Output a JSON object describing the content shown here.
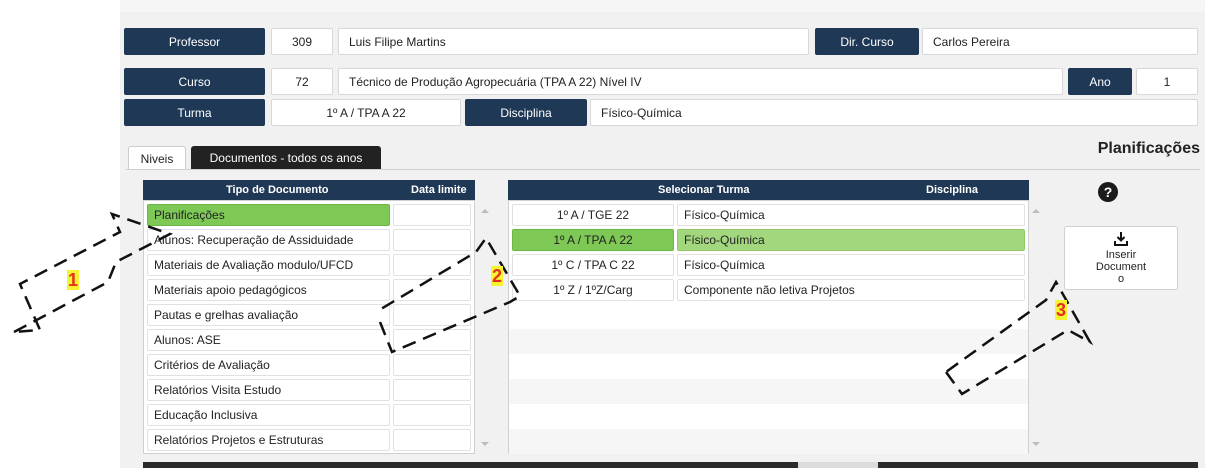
{
  "header": {
    "professor_label": "Professor",
    "professor_num": "309",
    "professor_name": "Luis Filipe Martins",
    "dir_curso_label": "Dir. Curso",
    "dir_curso_name": "Carlos Pereira",
    "curso_label": "Curso",
    "curso_num": "72",
    "curso_name": "Técnico de Produção Agropecuária (TPA A  22) Nível IV",
    "ano_label": "Ano",
    "ano_value": "1",
    "turma_label": "Turma",
    "turma_value": "1º A / TPA A 22",
    "disciplina_label": "Disciplina",
    "disciplina_value": "Físico-Química"
  },
  "tabs": {
    "niveis": "Niveis",
    "documentos": "Documentos - todos os anos"
  },
  "page_title": "Planificações",
  "doc_table": {
    "col_tipo": "Tipo de Documento",
    "col_data": "Data limite",
    "rows": [
      "Planificações",
      "Alunos: Recuperação de  Assiduidade",
      "Materiais de Avaliação modulo/UFCD",
      "Materiais apoio pedagógicos",
      "Pautas e grelhas avaliação",
      "Alunos: ASE",
      "Critérios de Avaliação",
      "Relatórios Visita Estudo",
      "Educação Inclusiva",
      "Relatórios Projetos e Estruturas"
    ]
  },
  "turma_table": {
    "col_selecionar": "Selecionar Turma",
    "col_disciplina": "Disciplina",
    "rows": [
      {
        "turma": "1º A / TGE 22",
        "disciplina": "Físico-Química"
      },
      {
        "turma": "1º A / TPA A 22",
        "disciplina": "Físico-Química"
      },
      {
        "turma": "1º C / TPA C 22",
        "disciplina": "Físico-Química"
      },
      {
        "turma": "1º Z / 1ºZ/Carg",
        "disciplina": "Componente não letiva Projetos"
      }
    ]
  },
  "help_symbol": "?",
  "insert_button": {
    "line1": "Inserir",
    "line2": "Document",
    "line3": "o",
    "icon": "download-tray-icon"
  },
  "annotations": [
    "1",
    "2",
    "3"
  ],
  "colors": {
    "navy": "#1f3855",
    "selected_green": "#7ec855",
    "row_green": "#a3d77e"
  }
}
